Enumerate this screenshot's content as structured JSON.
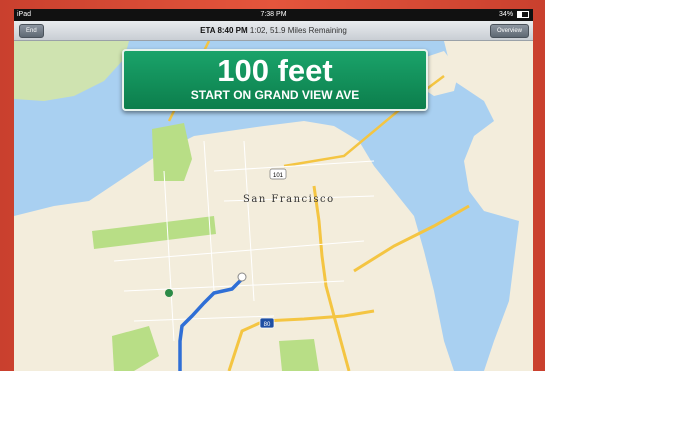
{
  "status_bar": {
    "device": "iPad",
    "time": "7:38 PM",
    "battery": "34%"
  },
  "nav_bar": {
    "end_label": "End",
    "eta_label": "ETA 8:40 PM",
    "eta_detail": "1:02, 51.9 Miles Remaining",
    "overview_label": "Overview"
  },
  "sign": {
    "distance": "100 feet",
    "instruction": "START ON GRAND VIEW AVE"
  },
  "map": {
    "city_label": "San Francisco",
    "highway_101": "101",
    "highway_80": "80"
  },
  "colors": {
    "sign_green": "#0e8a55",
    "route_blue": "#2f6fd6",
    "water": "#a9d0f1",
    "land": "#f3eddc",
    "park": "#b8de86",
    "highway": "#f4c542"
  }
}
